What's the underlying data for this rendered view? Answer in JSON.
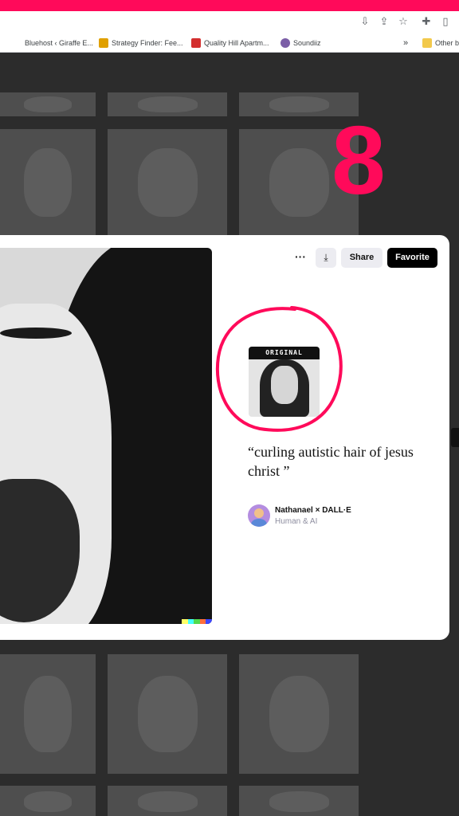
{
  "browser": {
    "toolbar_icons": [
      "download-app-icon",
      "share-icon",
      "star-icon",
      "extensions-icon",
      "sidebar-icon",
      "menu-icon"
    ],
    "bookmarks": [
      {
        "label": "Bluehost ‹ Giraffe E...",
        "icon_color": "#1f5fbf"
      },
      {
        "label": "Strategy Finder: Fee...",
        "icon_color": "#e0a000"
      },
      {
        "label": "Quality Hill Apartm...",
        "icon_color": "#d32f2f"
      },
      {
        "label": "Soundiiz",
        "icon_color": "#7b5ea7"
      }
    ],
    "overflow_label": "»",
    "other_bookmarks_label": "Other b"
  },
  "annotation": {
    "number": "8",
    "color": "#ff0a5a"
  },
  "modal": {
    "more_label": "···",
    "download_icon": "download-icon",
    "share_label": "Share",
    "favorite_label": "Favorite",
    "original_label": "ORIGINAL",
    "prompt": "“curling autistic hair of jesus christ ”",
    "author_name": "Nathanael × DALL·E",
    "author_sub": "Human & AI"
  },
  "colors": {
    "accent": "#ff0a5a",
    "favorite_bg": "#000000",
    "button_bg": "#ececf1"
  }
}
